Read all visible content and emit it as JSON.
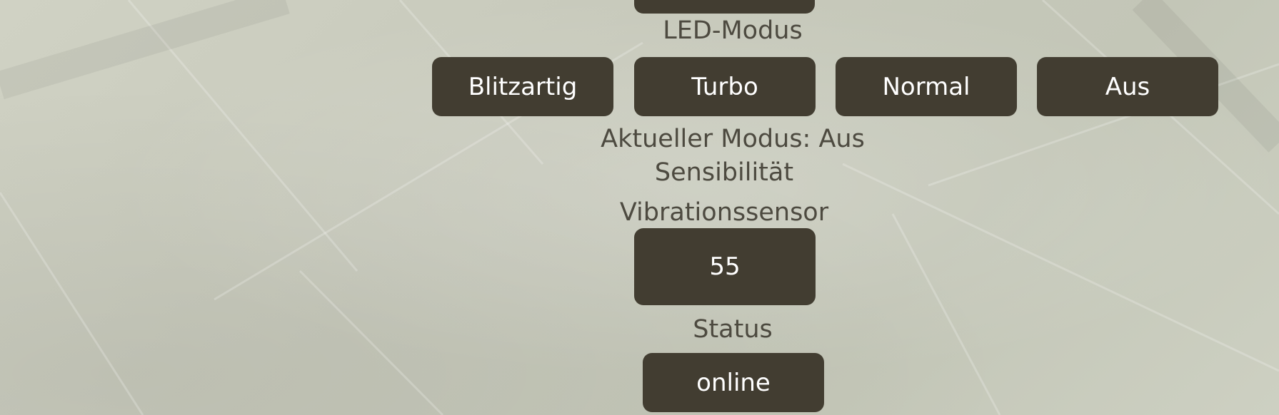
{
  "led": {
    "section_label": "LED-Modus",
    "buttons": [
      "Blitzartig",
      "Turbo",
      "Normal",
      "Aus"
    ],
    "current_mode_text": "Aktueller Modus: Aus"
  },
  "sensitivity": {
    "section_label": "Sensibilität",
    "sensor_label": "Vibrationssensor",
    "value": "55"
  },
  "status": {
    "section_label": "Status",
    "value": "online"
  },
  "colors": {
    "background": "#c9cbbd",
    "button": "#423d31",
    "button_text": "#ffffff",
    "label_text": "#4d4a40"
  }
}
